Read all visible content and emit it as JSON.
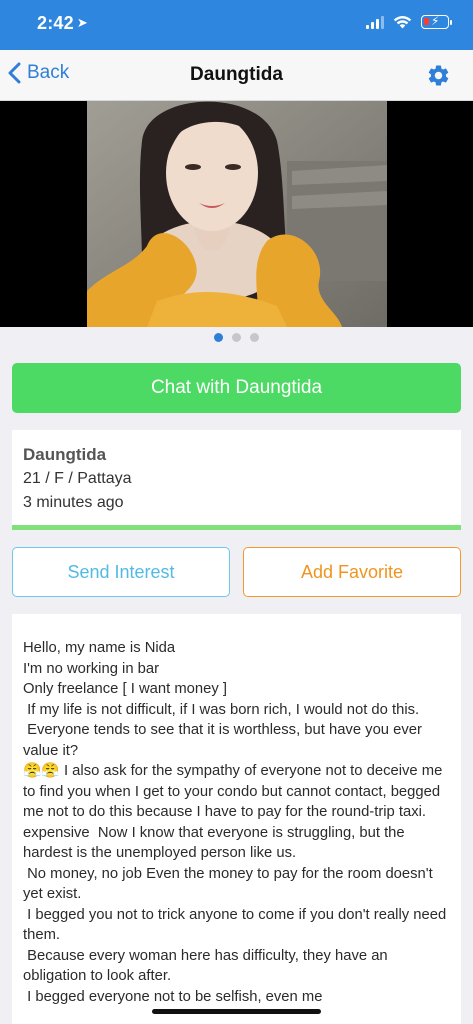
{
  "status_bar": {
    "time": "2:42",
    "location_icon": "location-arrow-icon",
    "signal_icon": "cellular-signal-icon",
    "wifi_icon": "wifi-icon",
    "battery_icon": "battery-low-charging-icon",
    "battery_color": "#ff3b30"
  },
  "nav": {
    "back_label": "Back",
    "title": "Daungtida",
    "settings_icon": "gear-icon",
    "accent_color": "#2f7fd9"
  },
  "gallery": {
    "image_count": 3,
    "current_index": 1
  },
  "chat_button": {
    "label": "Chat with Daungtida",
    "color": "#4cd964"
  },
  "profile": {
    "name": "Daungtida",
    "details": "21 / F / Pattaya",
    "last_seen": "3 minutes ago"
  },
  "actions": {
    "interest_label": "Send Interest",
    "favorite_label": "Add Favorite"
  },
  "bio": {
    "text": "Hello, my name is Nida\nI'm no working in bar\nOnly freelance [ I want money ]\n If my life is not difficult, if I was born rich, I would not do this.\n Everyone tends to see that it is worthless, but have you ever value it?\n😤😤 I also ask for the sympathy of everyone not to deceive me to find you when I get to your condo but cannot contact, begged me not to do this because I have to pay for the round-trip taxi. expensive  Now I know that everyone is struggling, but the hardest is the unemployed person like us.\n No money, no job Even the money to pay for the room doesn't yet exist.\n I begged you not to trick anyone to come if you don't really need them.\n Because every woman here has difficulty, they have an obligation to look after.\n I begged everyone not to be selfish, even me"
  }
}
